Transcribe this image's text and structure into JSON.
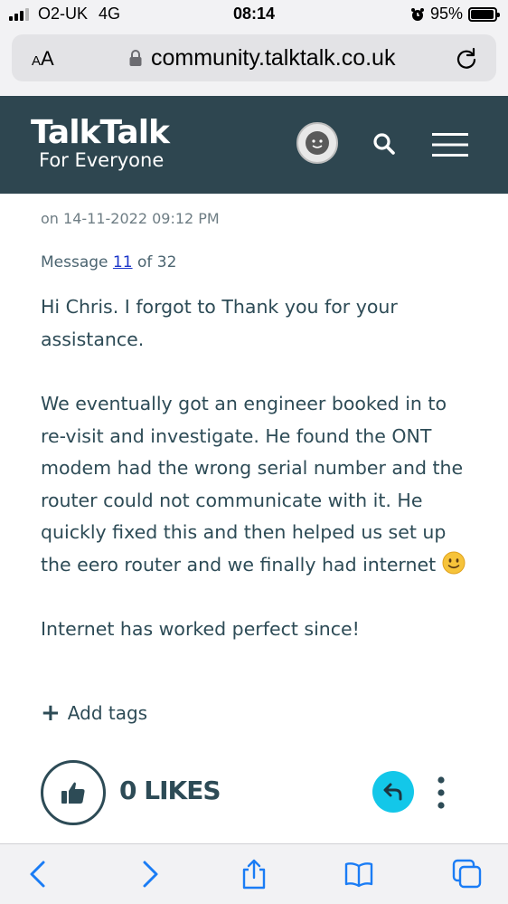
{
  "status_bar": {
    "carrier": "O2-UK",
    "network": "4G",
    "time": "08:14",
    "battery": "95%",
    "battery_level": 0.95,
    "signal_bars": 3,
    "signal_max": 4
  },
  "browser": {
    "text_size_label": "AA",
    "url": "community.talktalk.co.uk"
  },
  "site": {
    "logo_main": "TalkTalk",
    "logo_sub": "For Everyone",
    "header_color": "#2e4650"
  },
  "post": {
    "date": "on 14-11-2022 09:12 PM",
    "message_prefix": "Message",
    "message_number": "11",
    "message_suffix": "of 32",
    "paragraphs": [
      "Hi Chris. I forgot to Thank you for your assistance.",
      "We eventually got an engineer booked in to re-visit and investigate. He found the ONT modem had the wrong serial number and the router could not communicate with it. He quickly fixed this and then helped us set up the eero router and we finally had internet",
      "Internet has worked perfect since!"
    ],
    "emoji": "slightly-smiling-face-icon",
    "add_tags_label": "Add tags",
    "likes_label": "0 LIKES"
  },
  "colors": {
    "text": "#2d4b56",
    "link": "#1a35c9",
    "reply_accent": "#13c7e9",
    "ios_blue": "#1a7cf5"
  }
}
